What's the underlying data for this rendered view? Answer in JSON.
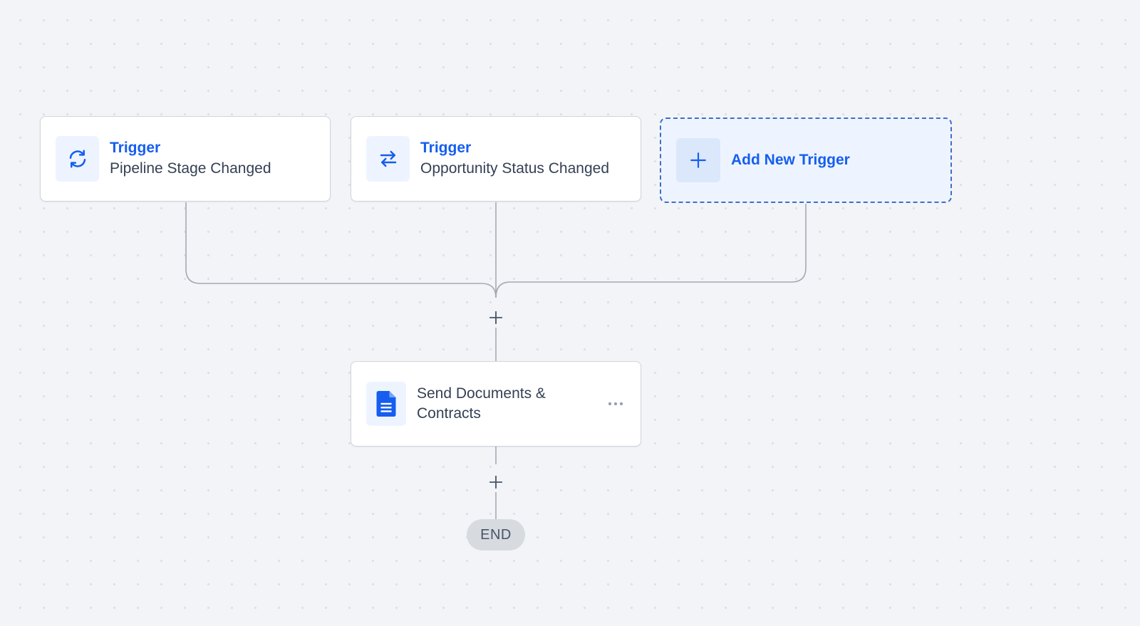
{
  "workflow": {
    "triggers": [
      {
        "kicker": "Trigger",
        "title": "Pipeline Stage Changed",
        "icon": "refresh-icon"
      },
      {
        "kicker": "Trigger",
        "title": "Opportunity Status Changed",
        "icon": "swap-arrows-icon"
      }
    ],
    "add_trigger": {
      "label": "Add New Trigger",
      "icon": "plus-icon"
    },
    "action": {
      "title": "Send Documents & Contracts",
      "icon": "document-icon",
      "menu_icon": "more-horizontal-icon"
    },
    "end_label": "END",
    "add_step_icon": "plus-icon"
  },
  "colors": {
    "accent": "#155eef",
    "canvas_bg": "#f2f4f7",
    "connector": "#98a2b3",
    "card_border": "#d0d5dd",
    "add_trigger_bg": "#eef4ff",
    "add_trigger_border": "#3e6fc6",
    "end_pill_bg": "#d7dbe0"
  }
}
